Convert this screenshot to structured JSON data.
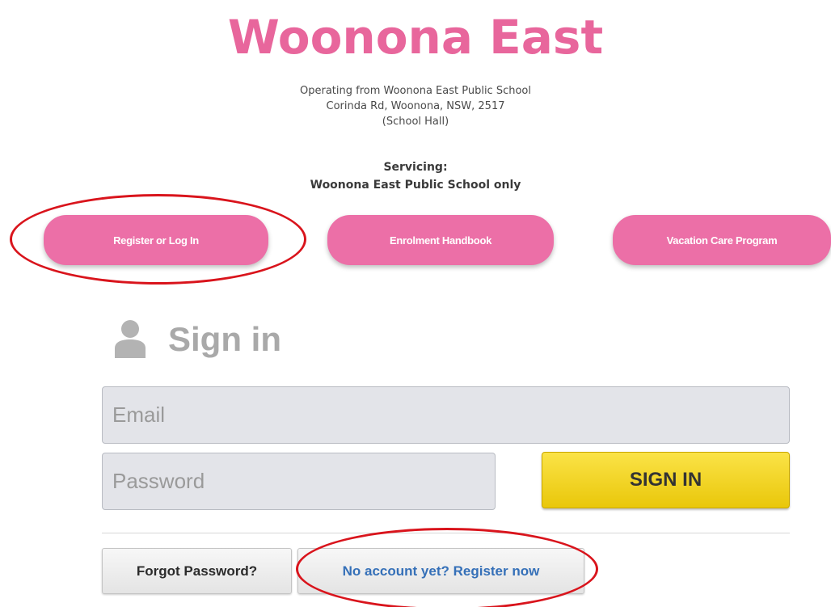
{
  "brand": {
    "title": "Woonona East",
    "color": "#e8669c"
  },
  "address": {
    "line1": "Operating from Woonona East Public School",
    "line2": "Corinda Rd, Woonona, NSW, 2517",
    "line3": "(School Hall)"
  },
  "servicing": {
    "label": "Servicing:",
    "value": "Woonona East Public School only"
  },
  "nav_buttons": {
    "register": "Register or Log In",
    "handbook": "Enrolment Handbook",
    "vacation": "Vacation Care Program",
    "color": "#ec6fa7"
  },
  "signin": {
    "heading": "Sign in",
    "icon": "user-icon",
    "email_placeholder": "Email",
    "password_placeholder": "Password",
    "submit_label": "SIGN IN",
    "forgot_label": "Forgot Password?",
    "register_label": "No account yet? Register now"
  },
  "annotations": {
    "highlight_color": "#d9141c"
  }
}
